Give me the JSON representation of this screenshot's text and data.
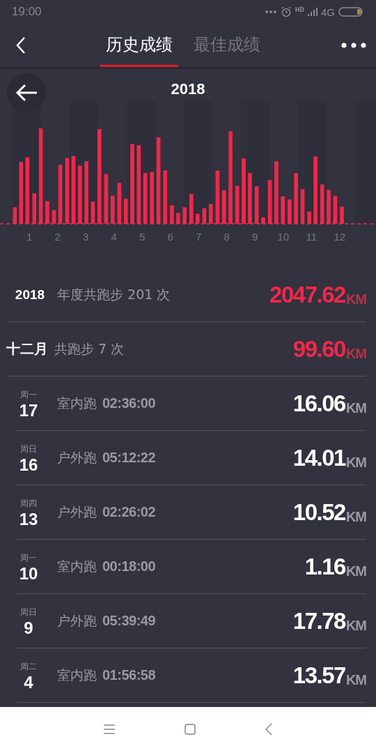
{
  "status_bar": {
    "time": "19:00",
    "hd": "HD",
    "network": "4G"
  },
  "tabs": [
    {
      "label": "历史成绩",
      "selected": true
    },
    {
      "label": "最佳成绩",
      "selected": false
    }
  ],
  "chart": {
    "title": "2018",
    "months": [
      "1",
      "2",
      "3",
      "4",
      "5",
      "6",
      "7",
      "8",
      "9",
      "10",
      "11",
      "12"
    ]
  },
  "year_summary": {
    "label": "2018",
    "text": "年度共跑步 201 次",
    "distance": "2047.62",
    "unit": "KM"
  },
  "month_summary": {
    "label": "十二月",
    "text": "共跑步 7 次",
    "distance": "99.60",
    "unit": "KM"
  },
  "runs": [
    {
      "weekday": "周一",
      "day": "17",
      "type": "室内跑",
      "duration": "02:36:00",
      "distance": "16.06",
      "unit": "KM"
    },
    {
      "weekday": "周日",
      "day": "16",
      "type": "户外跑",
      "duration": "05:12:22",
      "distance": "14.01",
      "unit": "KM"
    },
    {
      "weekday": "周四",
      "day": "13",
      "type": "户外跑",
      "duration": "02:26:02",
      "distance": "10.52",
      "unit": "KM"
    },
    {
      "weekday": "周一",
      "day": "10",
      "type": "室内跑",
      "duration": "00:18:00",
      "distance": "1.16",
      "unit": "KM"
    },
    {
      "weekday": "周日",
      "day": "9",
      "type": "户外跑",
      "duration": "05:39:49",
      "distance": "17.78",
      "unit": "KM"
    },
    {
      "weekday": "周二",
      "day": "4",
      "type": "室内跑",
      "duration": "01:56:58",
      "distance": "13.57",
      "unit": "KM"
    }
  ]
}
